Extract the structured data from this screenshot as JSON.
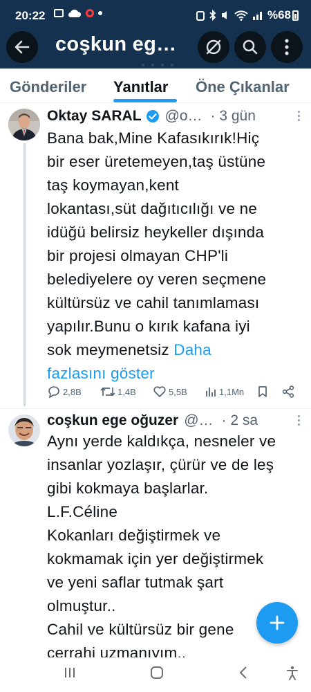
{
  "status_bar": {
    "time": "20:22",
    "battery": "%68"
  },
  "header": {
    "title": "coşkun eg…",
    "back_icon": "arrow-left-icon",
    "incognito_icon": "no-location-icon",
    "search_icon": "search-icon",
    "more_icon": "more-vertical-icon",
    "background_color": "#14324f"
  },
  "tabs": [
    {
      "label": "Gönderiler",
      "active": false
    },
    {
      "label": "Yanıtlar",
      "active": true
    },
    {
      "label": "Öne Çıkanlar",
      "active": false
    }
  ],
  "tweets": [
    {
      "name": "Oktay SARAL",
      "handle": "@o…",
      "time": "· 3 gün",
      "verified": true,
      "lines": [
        "Bana bak,Mine Kafasıkırık!Hiç",
        "bir eser üretemeyen,taş üstüne",
        "taş koymayan,kent",
        "lokantası,süt dağıtıcılığı ve ne",
        "idüğü belirsiz heykeller dışında",
        "bir projesi olmayan CHP'li",
        "belediyelere oy veren seçmene",
        "kültürsüz ve cahil tanımlaması",
        "yapılır.Bunu o kırık kafana iyi",
        "sok meymenetsiz"
      ],
      "show_more_part1": "Daha",
      "show_more_part2": "fazlasını göster",
      "stats": {
        "replies": "2,8B",
        "retweets": "1,4B",
        "likes": "5,5B",
        "views": "1,1Mn"
      }
    },
    {
      "name": "coşkun ege oğuzer",
      "handle": "@…",
      "time": "· 2 sa",
      "verified": false,
      "lines": [
        "Aynı yerde kaldıkça, nesneler ve",
        "insanlar yozlaşır, çürür ve de leş",
        "gibi kokmaya başlarlar.",
        "L.F.Céline",
        "Kokanları değiştirmek  ve",
        "kokmamak için yer değiştirmek",
        "ve yeni saflar tutmak şart",
        "olmuştur..",
        "Cahil ve kültürsüz bir gene",
        "cerrahi uzmanıyım.."
      ]
    }
  ],
  "fab": {
    "icon": "plus-icon",
    "color": "#1d9bf0"
  },
  "navbar": {
    "recent_icon": "recent-apps-icon",
    "home_icon": "home-icon",
    "back_icon": "nav-back-icon",
    "accessibility_icon": "accessibility-icon"
  }
}
